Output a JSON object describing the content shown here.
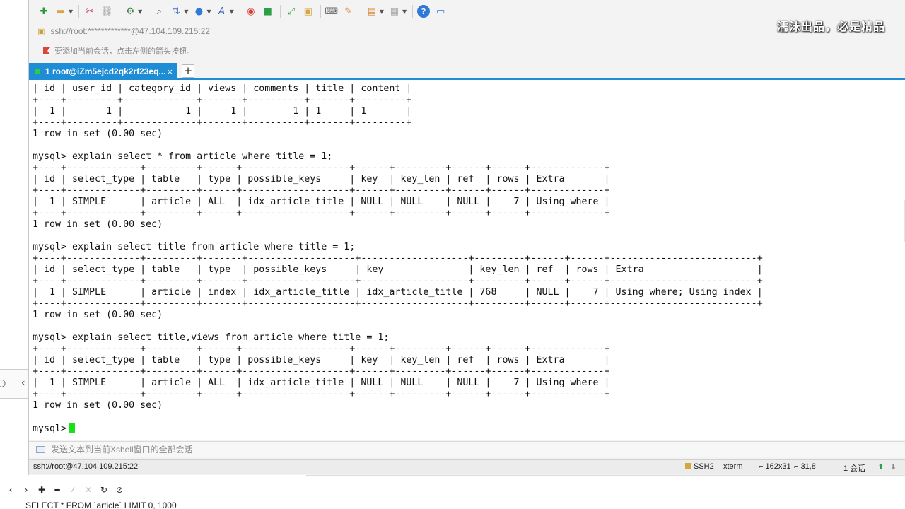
{
  "window": {
    "address": "ssh://root:*************@47.104.109.215:22",
    "tip": "要添加当前会话，点击左侧的箭头按钮。",
    "watermark": "濡沫出品，必是精品"
  },
  "toolbar": {
    "icons": [
      "new-session-icon",
      "open-folder-icon",
      "disconnect-icon",
      "reconnect-icon",
      "properties-icon",
      "find-icon",
      "transfer-icon",
      "globe-icon",
      "font-icon",
      "xftp-icon",
      "xmanager-icon",
      "fullscreen-icon",
      "lock-icon",
      "keyboard-icon",
      "highlight-icon",
      "compose-icon",
      "layout-icon",
      "help-icon",
      "chat-icon"
    ]
  },
  "tab": {
    "label": "1 root@iZm5ejcd2qk2rf23eq...",
    "close": "×",
    "add": "+"
  },
  "terminal": {
    "lines": [
      "| id | user_id | category_id | views | comments | title | content |",
      "+----+---------+-------------+-------+----------+-------+---------+",
      "|  1 |       1 |           1 |     1 |        1 | 1     | 1       |",
      "+----+---------+-------------+-------+----------+-------+---------+",
      "1 row in set (0.00 sec)",
      "",
      "mysql> explain select * from article where title = 1;",
      "+----+-------------+---------+------+-------------------+------+---------+------+------+-------------+",
      "| id | select_type | table   | type | possible_keys     | key  | key_len | ref  | rows | Extra       |",
      "+----+-------------+---------+------+-------------------+------+---------+------+------+-------------+",
      "|  1 | SIMPLE      | article | ALL  | idx_article_title | NULL | NULL    | NULL |    7 | Using where |",
      "+----+-------------+---------+------+-------------------+------+---------+------+------+-------------+",
      "1 row in set (0.00 sec)",
      "",
      "mysql> explain select title from article where title = 1;",
      "+----+-------------+---------+-------+-------------------+-------------------+---------+------+------+--------------------------+",
      "| id | select_type | table   | type  | possible_keys     | key               | key_len | ref  | rows | Extra                    |",
      "+----+-------------+---------+-------+-------------------+-------------------+---------+------+------+--------------------------+",
      "|  1 | SIMPLE      | article | index | idx_article_title | idx_article_title | 768     | NULL |    7 | Using where; Using index |",
      "+----+-------------+---------+-------+-------------------+-------------------+---------+------+------+--------------------------+",
      "1 row in set (0.00 sec)",
      "",
      "mysql> explain select title,views from article where title = 1;",
      "+----+-------------+---------+------+-------------------+------+---------+------+------+-------------+",
      "| id | select_type | table   | type | possible_keys     | key  | key_len | ref  | rows | Extra       |",
      "+----+-------------+---------+------+-------------------+------+---------+------+------+-------------+",
      "|  1 | SIMPLE      | article | ALL  | idx_article_title | NULL | NULL    | NULL |    7 | Using where |",
      "+----+-------------+---------+------+-------------------+------+---------+------+------+-------------+",
      "1 row in set (0.00 sec)",
      ""
    ],
    "prompt": "mysql>"
  },
  "sendbar": {
    "text": "发送文本到当前Xshell窗口的全部会话"
  },
  "status": {
    "session": "ssh://root@47.104.109.215:22",
    "protocol": "SSH2",
    "term": "xterm",
    "size": "162x31",
    "position": "31,8",
    "sessions": "1 会话"
  },
  "ide": {
    "sql": "SELECT * FROM `article` LIMIT 0, 1000"
  },
  "colors": {
    "tab_bg": "#1f8dd6",
    "cursor": "#18e018"
  }
}
